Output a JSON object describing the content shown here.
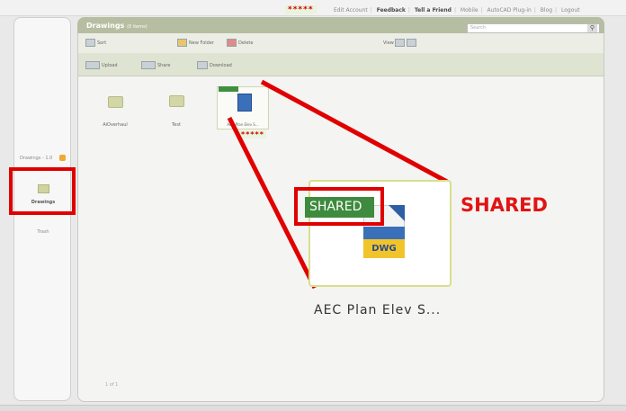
{
  "top_nav": {
    "redacted": "*****",
    "links": [
      "Edit Account",
      "Feedback",
      "Tell a Friend",
      "Mobile",
      "AutoCAD Plug-in",
      "Blog",
      "Logout"
    ]
  },
  "search": {
    "placeholder": "Search"
  },
  "sidebar": {
    "tag_label": "Drawings - 1.0",
    "items": [
      {
        "label": "Drawings",
        "active": true
      },
      {
        "label": "Trash",
        "active": false
      }
    ]
  },
  "main": {
    "title": "Drawings",
    "subtitle": "(0 items)",
    "toolbar1": {
      "items": [
        "Sort",
        "New Folder",
        "Delete",
        "View"
      ]
    },
    "toolbar2": {
      "items": [
        "Upload",
        "Share",
        "Download"
      ]
    },
    "files": [
      {
        "name": "AiOverhaul",
        "type": "folder"
      },
      {
        "name": "Test",
        "type": "folder"
      },
      {
        "name": "AEC Plan Elev S...",
        "type": "dwg",
        "shared": true,
        "redacted": "*****"
      }
    ],
    "pager": "1 of 1"
  },
  "callout": {
    "shared_tag": "SHARED",
    "filename": "AEC Plan Elev S...",
    "file_type": "DWG",
    "shared_label": "SHARED"
  },
  "colors": {
    "accent_red": "#e00000",
    "shared_green": "#3e8a3e",
    "header_olive": "#b5bea0"
  }
}
